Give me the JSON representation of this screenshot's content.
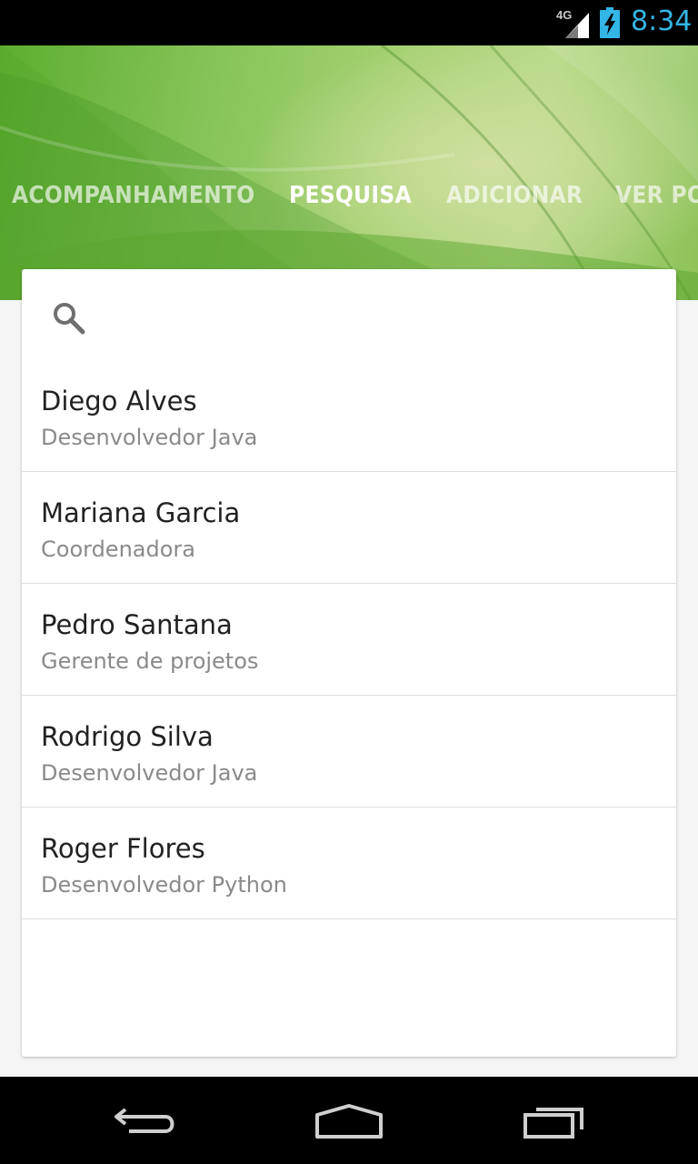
{
  "status_bar": {
    "network": "4G",
    "time": "8:34"
  },
  "tabs": [
    {
      "label": "ACOMPANHAMENTO",
      "active": false
    },
    {
      "label": "PESQUISA",
      "active": true
    },
    {
      "label": "ADICIONAR",
      "active": false
    },
    {
      "label": "VER PO",
      "active": false
    }
  ],
  "search": {
    "icon": "search-icon",
    "value": "",
    "placeholder": ""
  },
  "people": [
    {
      "name": "Diego Alves",
      "role": "Desenvolvedor Java"
    },
    {
      "name": "Mariana Garcia",
      "role": "Coordenadora"
    },
    {
      "name": "Pedro Santana",
      "role": "Gerente de projetos"
    },
    {
      "name": "Rodrigo Silva",
      "role": "Desenvolvedor Java"
    },
    {
      "name": "Roger Flores",
      "role": "Desenvolvedor Python"
    }
  ],
  "nav": {
    "back_icon": "back-icon",
    "home_icon": "home-icon",
    "recents_icon": "recent-apps-icon"
  },
  "colors": {
    "status_accent": "#33b5e5",
    "header_green": "#86c45a"
  }
}
